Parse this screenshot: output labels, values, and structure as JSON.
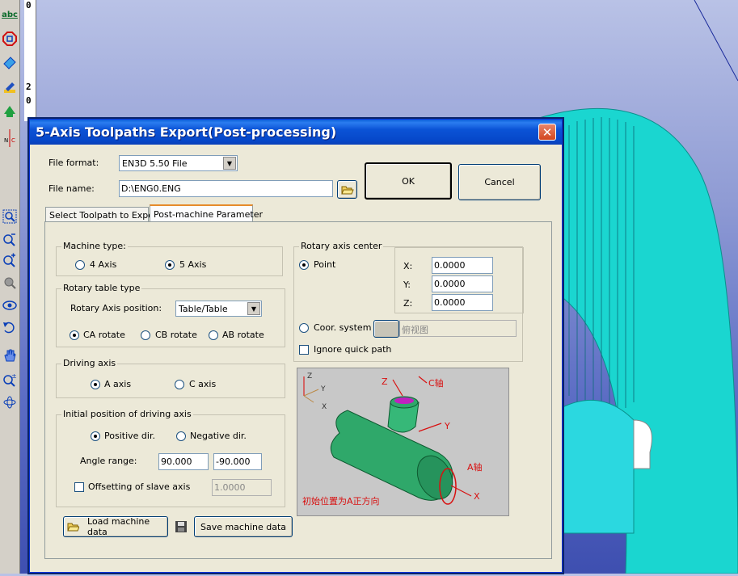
{
  "toolbar": {
    "icons": [
      "abc-text-icon",
      "stop-sign-icon",
      "eraser-icon",
      "highlighter-icon",
      "green-arrow-icon",
      "node-icon",
      "zoom-window-icon",
      "zoom-out-icon",
      "zoom-in-icon",
      "zoom-all-icon",
      "eye-icon",
      "rotate-view-icon",
      "hand-pan-icon",
      "zoom-dynamic-icon",
      "orbit-icon"
    ],
    "abc_label": "abc"
  },
  "ruler": {
    "labels": [
      "0",
      "2",
      "0"
    ]
  },
  "dialog": {
    "title": "5-Axis Toolpaths Export(Post-processing)",
    "close": "✕",
    "file_format_label": "File format:",
    "file_format_value": "EN3D 5.50 File",
    "file_name_label": "File name:",
    "file_name_value": "D:\\ENG0.ENG",
    "ok_label": "OK",
    "cancel_label": "Cancel",
    "tabs": [
      {
        "label": "Select Toolpath to Export"
      },
      {
        "label": "Post-machine Parameter"
      }
    ],
    "machine_type": {
      "title": "Machine type:",
      "options": [
        "4 Axis",
        "5 Axis"
      ],
      "selected": "5 Axis"
    },
    "rotary_table": {
      "title": "Rotary table type",
      "position_label": "Rotary Axis position:",
      "position_value": "Table/Table",
      "options": [
        "CA rotate",
        "CB rotate",
        "AB rotate"
      ],
      "selected": "CA rotate"
    },
    "driving_axis": {
      "title": "Driving axis",
      "options": [
        "A axis",
        "C axis"
      ],
      "selected": "A axis"
    },
    "initial_position": {
      "title": "Initial position of driving axis",
      "options": [
        "Positive dir.",
        "Negative dir."
      ],
      "selected": "Positive dir.",
      "angle_label": "Angle range:",
      "angle_min": "90.000",
      "angle_max": "-90.000",
      "offset_label": "Offsetting of slave axis",
      "offset_value": "1.0000"
    },
    "rotary_center": {
      "title": "Rotary axis center",
      "point_label": "Point",
      "x_label": "X:",
      "x_value": "0.0000",
      "y_label": "Y:",
      "y_value": "0.0000",
      "z_label": "Z:",
      "z_value": "0.0000",
      "coor_label": "Coor. system",
      "coor_value": "俯视图",
      "ignore_label": "Ignore quick path"
    },
    "diagram": {
      "z": "Z",
      "y": "Y",
      "x": "X",
      "c_axis": "C轴",
      "a_axis": "A轴",
      "caption": "初始位置为A正方向",
      "pipe_color": "#2fa86a",
      "marker_color": "#d81010"
    },
    "load_label": "Load machine data",
    "save_label": "Save machine data"
  }
}
